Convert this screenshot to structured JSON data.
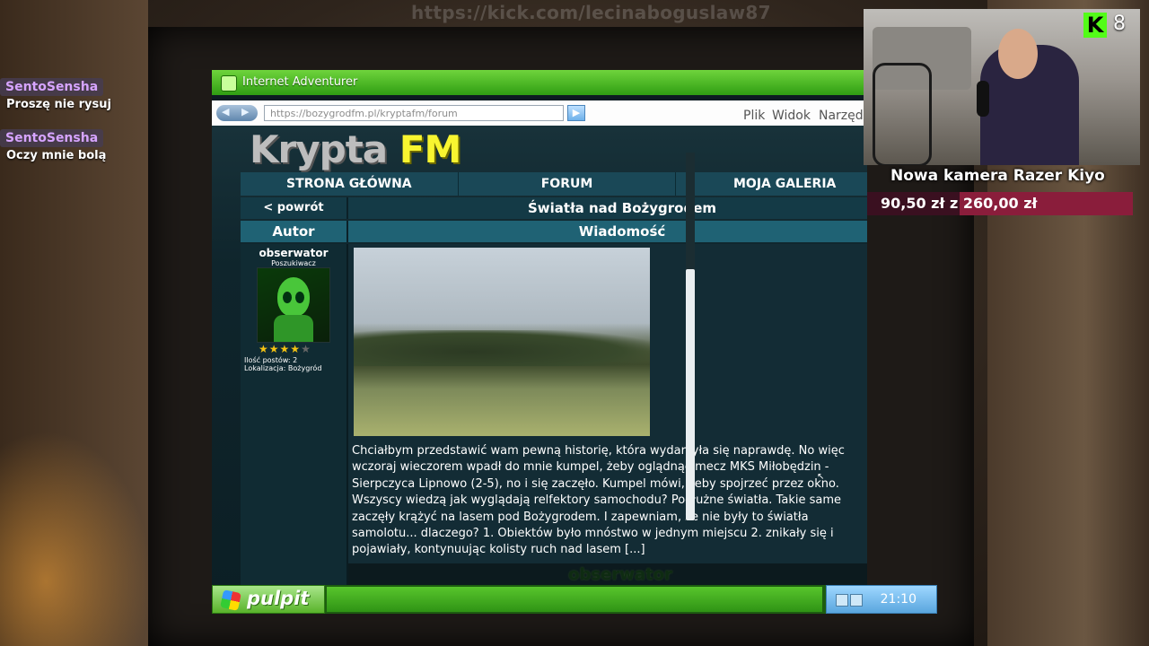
{
  "stream": {
    "watermark": "https://kick.com/lecinaboguslaw87",
    "viewer_count": "8",
    "goal": {
      "title": "Nowa kamera Razer Kiyo",
      "progress_text": "90,50 zł z 260,00 zł",
      "raised": 90.5,
      "target": 260.0
    }
  },
  "chat": [
    {
      "user": "SentoSensha",
      "message": "Proszę nie rysuj"
    },
    {
      "user": "SentoSensha",
      "message": "Oczy mnie bolą"
    }
  ],
  "browser": {
    "title": "Internet Adventurer",
    "url": "https://bozygrodfm.pl/kryptafm/forum",
    "menu": [
      "Plik",
      "Widok",
      "Narzędzia"
    ]
  },
  "site": {
    "logo_main": "Krypta",
    "logo_accent": "FM",
    "nav": [
      "STRONA GŁÓWNA",
      "FORUM",
      "MOJA GALERIA"
    ],
    "back_label": "< powrót",
    "topic_title": "Światła nad Bożygrodem",
    "col_author": "Autor",
    "col_message": "Wiadomość",
    "author": {
      "name": "obserwator",
      "rank": "Poszukiwacz",
      "rating": 4,
      "rating_max": 5,
      "posts": "Ilość postów: 2",
      "location": "Lokalizacja: Bożygród"
    },
    "post_text": "Chciałbym przedstawić wam pewną historię, która wydarzyła się naprawdę. No więc wczoraj wieczorem wpadł do mnie kumpel, żeby oglądnąć mecz MKS Miłobędzin - Sierpczyca Lipnowo (2-5), no i się zaczęło. Kumpel mówi, żeby spojrzeć przez okno. Wszyscy wiedzą jak wyglądają relfektory samochodu? Podłużne światła. Takie same zaczęły krążyć na lasem pod Bożygrodem. I zapewniam, że nie były to światła samolotu... dlaczego? 1. Obiektów było mnóstwo w jednym miejscu 2. znikały się i pojawiały, kontynuując kolisty ruch nad lasem [...]",
    "signature": "obserwator"
  },
  "taskbar": {
    "start_label": "pulpit",
    "clock": "21:10"
  }
}
